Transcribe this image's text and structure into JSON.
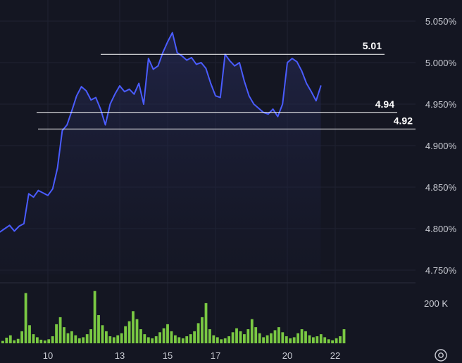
{
  "chart_data": {
    "type": "line",
    "title": "",
    "xlabel": "",
    "ylabel": "",
    "y_unit": "%",
    "ylim": [
      4.73,
      5.06
    ],
    "y_ticks": [
      "4.750%",
      "4.800%",
      "4.850%",
      "4.900%",
      "4.950%",
      "5.000%",
      "5.050%"
    ],
    "x_ticks": [
      "10",
      "13",
      "15",
      "17",
      "20",
      "22"
    ],
    "grid": true,
    "series": [
      {
        "color": "#4a5cff",
        "x": [
          8.0,
          8.2,
          8.4,
          8.6,
          8.8,
          9.0,
          9.2,
          9.4,
          9.6,
          9.8,
          10.0,
          10.2,
          10.4,
          10.6,
          10.8,
          11.0,
          11.2,
          11.4,
          11.6,
          11.8,
          12.0,
          12.2,
          12.4,
          12.6,
          12.8,
          13.0,
          13.2,
          13.4,
          13.6,
          13.8,
          14.0,
          14.2,
          14.4,
          14.6,
          14.8,
          15.0,
          15.2,
          15.4,
          15.6,
          15.8,
          16.0,
          16.2,
          16.4,
          16.6,
          16.8,
          17.0,
          17.2,
          17.4,
          17.6,
          17.8,
          18.0,
          18.2,
          18.4,
          18.6,
          18.8,
          19.0,
          19.2,
          19.4,
          19.6,
          19.8,
          20.0,
          20.2,
          20.4,
          20.6,
          20.8,
          21.0,
          21.2,
          21.4
        ],
        "y": [
          4.796,
          4.8,
          4.804,
          4.797,
          4.803,
          4.806,
          4.842,
          4.838,
          4.846,
          4.843,
          4.84,
          4.848,
          4.873,
          4.918,
          4.925,
          4.942,
          4.96,
          4.971,
          4.966,
          4.955,
          4.958,
          4.944,
          4.925,
          4.95,
          4.962,
          4.972,
          4.965,
          4.968,
          4.962,
          4.975,
          4.95,
          5.005,
          4.992,
          4.996,
          5.012,
          5.025,
          5.036,
          5.012,
          5.008,
          5.003,
          5.006,
          4.998,
          5.0,
          4.993,
          4.975,
          4.96,
          4.958,
          5.01,
          5.002,
          4.996,
          5.0,
          4.978,
          4.96,
          4.95,
          4.945,
          4.94,
          4.938,
          4.944,
          4.935,
          4.95,
          5.0,
          5.005,
          5.001,
          4.99,
          4.975,
          4.965,
          4.954,
          4.972
        ]
      }
    ],
    "horizontal_lines": [
      {
        "value": 5.01,
        "label": "5.01"
      },
      {
        "value": 4.94,
        "label": "4.94"
      },
      {
        "value": 4.92,
        "label": "4.92"
      }
    ],
    "volume": {
      "color": "#7ac943",
      "axis_tick_label": "200 K",
      "tick_value": 200000,
      "max_value": 280000,
      "values": [
        12000,
        28000,
        40000,
        15000,
        22000,
        60000,
        250000,
        90000,
        45000,
        30000,
        18000,
        14000,
        20000,
        35000,
        95000,
        130000,
        80000,
        50000,
        60000,
        40000,
        25000,
        30000,
        45000,
        70000,
        260000,
        140000,
        90000,
        60000,
        35000,
        30000,
        40000,
        50000,
        85000,
        110000,
        160000,
        120000,
        70000,
        45000,
        30000,
        25000,
        35000,
        55000,
        75000,
        95000,
        60000,
        40000,
        30000,
        25000,
        35000,
        45000,
        60000,
        100000,
        130000,
        200000,
        70000,
        40000,
        30000,
        20000,
        25000,
        35000,
        55000,
        75000,
        60000,
        45000,
        70000,
        120000,
        80000,
        50000,
        30000,
        40000,
        50000,
        65000,
        80000,
        55000,
        35000,
        25000,
        30000,
        50000,
        70000,
        60000,
        40000,
        30000,
        35000,
        45000,
        30000,
        20000,
        15000,
        25000,
        35000,
        70000
      ]
    }
  },
  "controls": {
    "settings_icon": "gear-icon"
  }
}
